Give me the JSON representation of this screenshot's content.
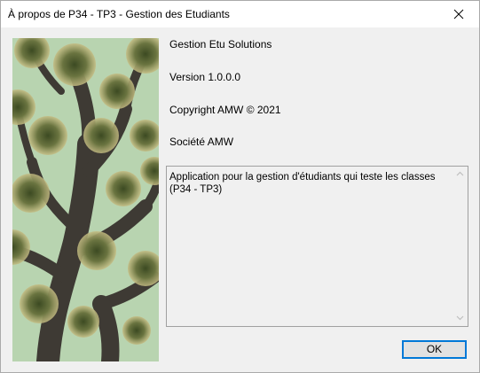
{
  "window": {
    "title": "À propos de P34 - TP3 - Gestion des Etudiants"
  },
  "about": {
    "product": "Gestion Etu Solutions",
    "version": "Version 1.0.0.0",
    "copyright": "Copyright AMW © 2021",
    "company": "Société AMW",
    "description": "Application pour la gestion d'étudiants qui teste les classes (P34 - TP3)"
  },
  "buttons": {
    "ok_label": "OK"
  },
  "colors": {
    "accent": "#0078d7",
    "dialog_bg": "#f0f0f0",
    "sky": "#b8d4b0"
  },
  "icons": {
    "close": "close-icon",
    "scroll_up": "scroll-up-arrow-icon",
    "scroll_down": "scroll-down-arrow-icon"
  }
}
